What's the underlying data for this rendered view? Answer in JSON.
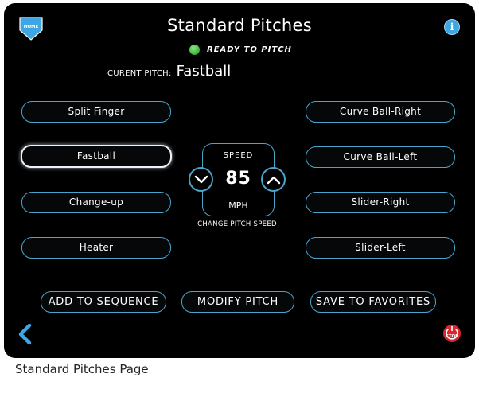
{
  "header": {
    "home_label": "HOME",
    "title": "Standard Pitches",
    "info_label": "i",
    "status": "READY TO PITCH",
    "status_color": "#3ab03a"
  },
  "current_pitch": {
    "label": "CURENT PITCH:",
    "value": "Fastball"
  },
  "pitches_left": [
    {
      "label": "Split Finger",
      "selected": false
    },
    {
      "label": "Fastball",
      "selected": true
    },
    {
      "label": "Change-up",
      "selected": false
    },
    {
      "label": "Heater",
      "selected": false
    }
  ],
  "pitches_right": [
    {
      "label": "Curve Ball-Right",
      "selected": false
    },
    {
      "label": "Curve Ball-Left",
      "selected": false
    },
    {
      "label": "Slider-Right",
      "selected": false
    },
    {
      "label": "Slider-Left",
      "selected": false
    }
  ],
  "speed": {
    "label": "SPEED",
    "value": "85",
    "unit": "MPH",
    "change_label": "CHANGE PITCH SPEED",
    "decrease_icon": "chevron-down-icon",
    "increase_icon": "chevron-up-icon"
  },
  "actions": {
    "add_to_sequence": "ADD TO SEQUENCE",
    "modify_pitch": "MODIFY PITCH",
    "save_to_favorites": "SAVE TO FAVORITES"
  },
  "footer": {
    "back_icon": "chevron-left-icon",
    "stop_label": "STOP"
  },
  "colors": {
    "accent": "#4aa4c9",
    "background": "#000000",
    "stop_red": "#d7282f",
    "home_blue": "#3fa6e4"
  },
  "caption": "Standard Pitches Page"
}
